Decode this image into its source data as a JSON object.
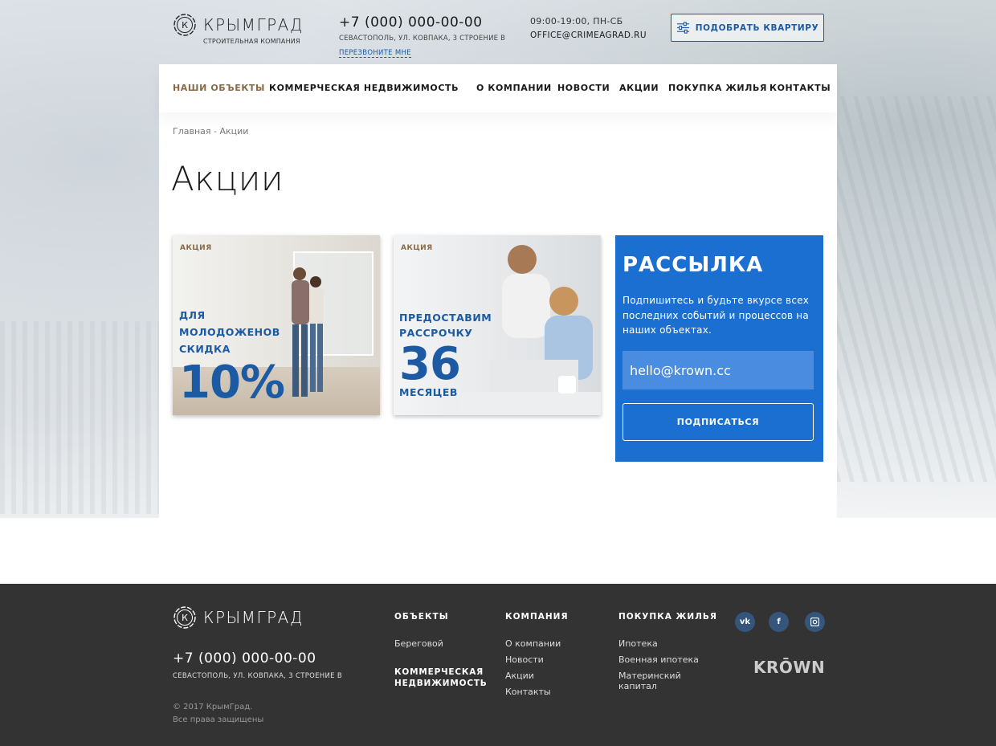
{
  "header": {
    "logo_text": "КРЫМГРАД",
    "logo_sub": "СТРОИТЕЛЬНАЯ КОМПАНИЯ",
    "phone": "+7 (000) 000-00-00",
    "address": "СЕВАСТОПОЛЬ, УЛ. КОВПАКА, 3 СТРОЕНИЕ В",
    "callback": "ПЕРЕЗВОНИТЕ МНЕ",
    "hours": "09:00-19:00, ПН-СБ",
    "email": "OFFICE@CRIMEAGRAD.RU",
    "pick_button": "ПОДОБРАТЬ КВАРТИРУ"
  },
  "nav": {
    "items": [
      {
        "label": "НАШИ ОБЪЕКТЫ",
        "active": true
      },
      {
        "label": "КОММЕРЧЕСКАЯ НЕДВИЖИМОСТЬ",
        "active": false
      },
      {
        "label": "О КОМПАНИИ",
        "active": false
      },
      {
        "label": "НОВОСТИ",
        "active": false
      },
      {
        "label": "АКЦИИ",
        "active": false
      },
      {
        "label": "ПОКУПКА ЖИЛЬЯ",
        "active": false
      },
      {
        "label": "КОНТАКТЫ",
        "active": false
      }
    ]
  },
  "breadcrumb": "Главная - Акции",
  "page_title": "Акции",
  "promos": [
    {
      "tag": "АКЦИЯ",
      "line1": "ДЛЯ",
      "line2": "МОЛОДОЖЕНОВ",
      "line3": "СКИДКА",
      "big": "10%"
    },
    {
      "tag": "АКЦИЯ",
      "line1": "ПРЕДОСТАВИМ",
      "line2": "РАССРОЧКУ",
      "big": "36",
      "line3": "МЕСЯЦЕВ"
    }
  ],
  "newsletter": {
    "title": "РАССЫЛКА",
    "text": "Подпишитесь и будьте вкурсе всех последних событий и процессов на наших объектах.",
    "input_value": "hello@krown.cc",
    "button": "ПОДПИСАТЬСЯ"
  },
  "footer": {
    "logo_text": "КРЫМГРАД",
    "phone": "+7 (000) 000-00-00",
    "address": "СЕВАСТОПОЛЬ, УЛ. КОВПАКА, 3 СТРОЕНИЕ В",
    "copy1": "© 2017 КрымГрад.",
    "copy2": "Все права защищены",
    "col_objects": {
      "title": "ОБЪЕКТЫ",
      "link1": "Береговой",
      "link2": "КОММЕРЧЕСКАЯ НЕДВИЖИМОСТЬ"
    },
    "col_company": {
      "title": "КОМПАНИЯ",
      "links": [
        "О компании",
        "Новости",
        "Акции",
        "Контакты"
      ]
    },
    "col_buy": {
      "title": "ПОКУПКА ЖИЛЬЯ",
      "links": [
        "Ипотека",
        "Военная ипотека",
        "Материнский капитал"
      ]
    },
    "social": [
      "vk-icon",
      "facebook-icon",
      "instagram-icon"
    ],
    "krown": "KRŌWN"
  },
  "colors": {
    "accent_blue": "#1c5aa3",
    "newsletter_bg": "#1b6fd1",
    "active_nav": "#8a6a45",
    "footer_bg": "#333333"
  }
}
